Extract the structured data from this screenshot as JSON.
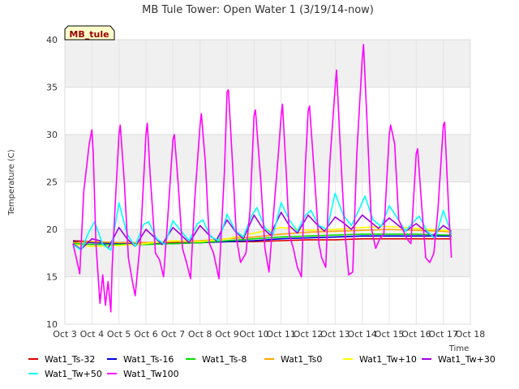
{
  "chart_data": {
    "type": "line",
    "title": "MB Tule Tower: Open Water 1 (3/19/14-now)",
    "ylabel": "Temperature (C)",
    "xlabel": "Time",
    "ylim": [
      10,
      40
    ],
    "xlim": [
      3,
      18
    ],
    "yticks": [
      10,
      15,
      20,
      25,
      30,
      35,
      40
    ],
    "xticks": [
      3,
      4,
      5,
      6,
      7,
      8,
      9,
      10,
      11,
      12,
      13,
      14,
      15,
      16,
      17,
      18
    ],
    "xtick_labels": [
      "Oct 3",
      "Oct 4",
      "Oct 5",
      "Oct 6",
      "Oct 7",
      "Oct 8",
      "Oct 9",
      "Oct 10",
      "Oct 11",
      "Oct 12",
      "Oct 13",
      "Oct 14",
      "Oct 15",
      "Oct 16",
      "Oct 17",
      "Oct 18"
    ],
    "grid": true,
    "legend_position": "bottom",
    "tag": "MB_tule",
    "series": [
      {
        "name": "Wat1_Ts-32",
        "color": "#e00000",
        "x": [
          3.3,
          4,
          5,
          6,
          7,
          8,
          9,
          10,
          11,
          12,
          13,
          14,
          15,
          16,
          17,
          17.3
        ],
        "y": [
          18.8,
          18.7,
          18.6,
          18.6,
          18.6,
          18.6,
          18.7,
          18.7,
          18.8,
          18.9,
          18.9,
          19.0,
          19.0,
          19.0,
          19.0,
          19.0
        ]
      },
      {
        "name": "Wat1_Ts-16",
        "color": "#0000e0",
        "x": [
          3.3,
          4,
          5,
          6,
          7,
          8,
          9,
          10,
          11,
          12,
          13,
          14,
          15,
          16,
          17,
          17.3
        ],
        "y": [
          18.7,
          18.6,
          18.5,
          18.5,
          18.5,
          18.6,
          18.7,
          18.8,
          19.0,
          19.1,
          19.2,
          19.3,
          19.3,
          19.3,
          19.3,
          19.3
        ]
      },
      {
        "name": "Wat1_Ts-8",
        "color": "#00e000",
        "x": [
          3.3,
          4,
          5,
          6,
          7,
          8,
          9,
          10,
          11,
          12,
          13,
          14,
          15,
          16,
          17,
          17.3
        ],
        "y": [
          18.5,
          18.4,
          18.4,
          18.4,
          18.5,
          18.6,
          18.8,
          19.0,
          19.2,
          19.3,
          19.4,
          19.5,
          19.5,
          19.5,
          19.4,
          19.4
        ]
      },
      {
        "name": "Wat1_Ts0",
        "color": "#ffa500",
        "x": [
          3.3,
          4,
          5,
          6,
          7,
          8,
          9,
          10,
          11,
          12,
          13,
          14,
          15,
          16,
          17,
          17.3
        ],
        "y": [
          18.6,
          18.7,
          18.6,
          18.6,
          18.7,
          18.8,
          19.0,
          19.2,
          19.5,
          19.7,
          19.8,
          19.9,
          20.0,
          19.9,
          19.8,
          19.7
        ]
      },
      {
        "name": "Wat1_Tw+10",
        "color": "#ffff00",
        "x": [
          3.3,
          4,
          5,
          6,
          7,
          8,
          9,
          10,
          11,
          12,
          13,
          14,
          15,
          16,
          17,
          17.3
        ],
        "y": [
          18.4,
          18.2,
          18.3,
          18.5,
          18.8,
          18.7,
          19.0,
          19.6,
          20.2,
          19.9,
          20.0,
          20.2,
          20.3,
          20.1,
          19.9,
          19.8
        ]
      },
      {
        "name": "Wat1_Tw+30",
        "color": "#a000e0",
        "x": [
          3.3,
          3.6,
          4,
          4.3,
          4.6,
          5,
          5.3,
          5.6,
          6,
          6.3,
          6.6,
          7,
          7.3,
          7.6,
          8,
          8.3,
          8.6,
          9,
          9.3,
          9.6,
          10,
          10.3,
          10.6,
          11,
          11.3,
          11.6,
          12,
          12.3,
          12.6,
          13,
          13.3,
          13.6,
          14,
          14.3,
          14.6,
          15,
          15.3,
          15.6,
          16,
          16.3,
          16.6,
          17,
          17.3
        ],
        "y": [
          18.5,
          17.9,
          19.0,
          18.8,
          18.0,
          20.2,
          19.0,
          18.2,
          20.0,
          19.2,
          18.4,
          20.2,
          19.4,
          18.6,
          20.4,
          19.5,
          18.8,
          21.0,
          19.8,
          19.0,
          21.5,
          20.2,
          19.4,
          21.8,
          20.4,
          19.6,
          21.5,
          20.6,
          19.8,
          21.3,
          20.7,
          20.0,
          21.5,
          20.8,
          20.1,
          21.2,
          20.5,
          19.8,
          20.6,
          19.9,
          19.3,
          20.4,
          19.8
        ]
      },
      {
        "name": "Wat1_Tw+50",
        "color": "#00ffff",
        "x": [
          3.3,
          3.6,
          3.9,
          4.1,
          4.4,
          4.7,
          5,
          5.3,
          5.6,
          5.9,
          6.1,
          6.4,
          6.7,
          7,
          7.3,
          7.6,
          7.9,
          8.1,
          8.4,
          8.7,
          9,
          9.3,
          9.6,
          9.9,
          10.1,
          10.4,
          10.7,
          11,
          11.3,
          11.6,
          11.9,
          12.1,
          12.4,
          12.7,
          13,
          13.3,
          13.6,
          13.9,
          14.1,
          14.4,
          14.7,
          15,
          15.3,
          15.6,
          15.9,
          16.1,
          16.4,
          16.7,
          17,
          17.3
        ],
        "y": [
          18.4,
          17.8,
          19.8,
          20.8,
          18.4,
          17.8,
          22.8,
          19.5,
          18.2,
          20.5,
          20.8,
          19.0,
          18.4,
          20.9,
          19.8,
          18.8,
          20.6,
          21.0,
          19.2,
          18.8,
          21.6,
          19.9,
          19.2,
          21.4,
          22.3,
          20.2,
          19.4,
          22.8,
          21.0,
          19.8,
          21.5,
          22.0,
          20.4,
          20.0,
          23.8,
          21.5,
          20.4,
          22.2,
          23.5,
          21.0,
          20.3,
          22.5,
          21.2,
          19.8,
          20.8,
          21.4,
          19.8,
          19.0,
          22.0,
          19.5
        ]
      },
      {
        "name": "Wat1_Tw100",
        "color": "#ff00ff",
        "x": [
          3.3,
          3.5,
          3.55,
          3.7,
          3.9,
          4,
          4.05,
          4.15,
          4.3,
          4.4,
          4.5,
          4.6,
          4.7,
          4.75,
          4.85,
          5.0,
          5.05,
          5.2,
          5.35,
          5.5,
          5.6,
          5.8,
          6.0,
          6.05,
          6.15,
          6.35,
          6.5,
          6.65,
          6.8,
          7.0,
          7.05,
          7.2,
          7.35,
          7.5,
          7.65,
          7.8,
          8.0,
          8.05,
          8.2,
          8.35,
          8.5,
          8.7,
          8.9,
          9.0,
          9.05,
          9.2,
          9.35,
          9.5,
          9.7,
          9.85,
          10.0,
          10.05,
          10.25,
          10.4,
          10.55,
          10.7,
          10.9,
          11.0,
          11.05,
          11.2,
          11.3,
          11.45,
          11.6,
          11.75,
          11.9,
          12.0,
          12.05,
          12.25,
          12.4,
          12.5,
          12.65,
          12.8,
          13.0,
          13.05,
          13.2,
          13.35,
          13.5,
          13.65,
          13.8,
          14.0,
          14.05,
          14.2,
          14.35,
          14.5,
          14.65,
          14.8,
          15.0,
          15.05,
          15.2,
          15.35,
          15.5,
          15.65,
          15.8,
          16.0,
          16.05,
          16.2,
          16.35,
          16.5,
          16.65,
          16.8,
          17.0,
          17.05,
          17.2,
          17.3
        ],
        "y": [
          18.5,
          16.0,
          15.3,
          24.0,
          29.0,
          30.5,
          28.0,
          18.5,
          12.2,
          15.2,
          12.0,
          14.5,
          11.3,
          16.0,
          22.0,
          30.0,
          31.0,
          25.0,
          17.0,
          14.5,
          13.0,
          19.0,
          30.0,
          31.2,
          26.0,
          17.5,
          16.8,
          15.0,
          21.0,
          29.5,
          30.0,
          24.5,
          18.0,
          16.5,
          14.8,
          23.0,
          31.0,
          32.2,
          27.0,
          18.5,
          17.5,
          14.8,
          26.0,
          34.5,
          34.7,
          27.0,
          19.0,
          16.5,
          17.5,
          22.0,
          32.0,
          32.6,
          25.0,
          18.0,
          15.5,
          21.0,
          28.0,
          32.0,
          33.2,
          25.5,
          19.5,
          18.0,
          16.0,
          15.0,
          27.0,
          32.5,
          33.0,
          25.0,
          18.5,
          17.0,
          16.0,
          27.0,
          35.0,
          36.8,
          28.0,
          20.0,
          15.2,
          15.5,
          28.0,
          38.0,
          39.5,
          30.0,
          20.0,
          18.0,
          19.0,
          19.5,
          30.0,
          31.0,
          29.0,
          21.0,
          20.0,
          19.0,
          18.5,
          28.0,
          28.5,
          22.5,
          17.0,
          16.5,
          17.5,
          22.0,
          31.0,
          31.3,
          22.0,
          17.0
        ]
      }
    ]
  }
}
